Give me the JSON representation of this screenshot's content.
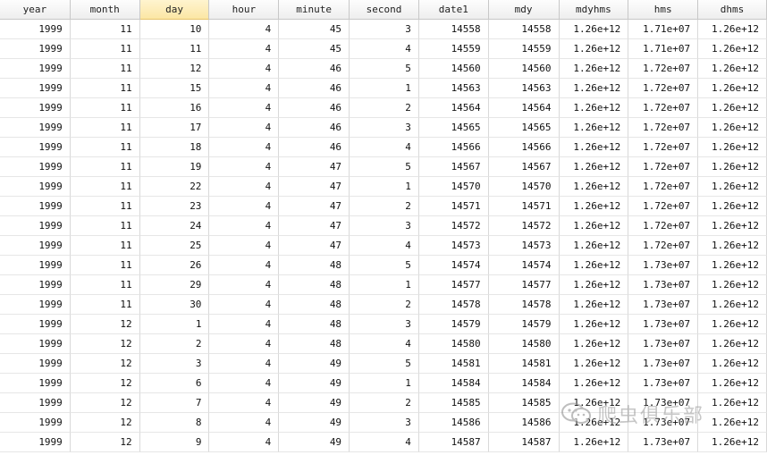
{
  "columns": [
    "year",
    "month",
    "day",
    "hour",
    "minute",
    "second",
    "date1",
    "mdy",
    "mdyhms",
    "hms",
    "dhms"
  ],
  "selected_column": "day",
  "rows": [
    [
      "1999",
      "11",
      "10",
      "4",
      "45",
      "3",
      "14558",
      "14558",
      "1.26e+12",
      "1.71e+07",
      "1.26e+12"
    ],
    [
      "1999",
      "11",
      "11",
      "4",
      "45",
      "4",
      "14559",
      "14559",
      "1.26e+12",
      "1.71e+07",
      "1.26e+12"
    ],
    [
      "1999",
      "11",
      "12",
      "4",
      "46",
      "5",
      "14560",
      "14560",
      "1.26e+12",
      "1.72e+07",
      "1.26e+12"
    ],
    [
      "1999",
      "11",
      "15",
      "4",
      "46",
      "1",
      "14563",
      "14563",
      "1.26e+12",
      "1.72e+07",
      "1.26e+12"
    ],
    [
      "1999",
      "11",
      "16",
      "4",
      "46",
      "2",
      "14564",
      "14564",
      "1.26e+12",
      "1.72e+07",
      "1.26e+12"
    ],
    [
      "1999",
      "11",
      "17",
      "4",
      "46",
      "3",
      "14565",
      "14565",
      "1.26e+12",
      "1.72e+07",
      "1.26e+12"
    ],
    [
      "1999",
      "11",
      "18",
      "4",
      "46",
      "4",
      "14566",
      "14566",
      "1.26e+12",
      "1.72e+07",
      "1.26e+12"
    ],
    [
      "1999",
      "11",
      "19",
      "4",
      "47",
      "5",
      "14567",
      "14567",
      "1.26e+12",
      "1.72e+07",
      "1.26e+12"
    ],
    [
      "1999",
      "11",
      "22",
      "4",
      "47",
      "1",
      "14570",
      "14570",
      "1.26e+12",
      "1.72e+07",
      "1.26e+12"
    ],
    [
      "1999",
      "11",
      "23",
      "4",
      "47",
      "2",
      "14571",
      "14571",
      "1.26e+12",
      "1.72e+07",
      "1.26e+12"
    ],
    [
      "1999",
      "11",
      "24",
      "4",
      "47",
      "3",
      "14572",
      "14572",
      "1.26e+12",
      "1.72e+07",
      "1.26e+12"
    ],
    [
      "1999",
      "11",
      "25",
      "4",
      "47",
      "4",
      "14573",
      "14573",
      "1.26e+12",
      "1.72e+07",
      "1.26e+12"
    ],
    [
      "1999",
      "11",
      "26",
      "4",
      "48",
      "5",
      "14574",
      "14574",
      "1.26e+12",
      "1.73e+07",
      "1.26e+12"
    ],
    [
      "1999",
      "11",
      "29",
      "4",
      "48",
      "1",
      "14577",
      "14577",
      "1.26e+12",
      "1.73e+07",
      "1.26e+12"
    ],
    [
      "1999",
      "11",
      "30",
      "4",
      "48",
      "2",
      "14578",
      "14578",
      "1.26e+12",
      "1.73e+07",
      "1.26e+12"
    ],
    [
      "1999",
      "12",
      "1",
      "4",
      "48",
      "3",
      "14579",
      "14579",
      "1.26e+12",
      "1.73e+07",
      "1.26e+12"
    ],
    [
      "1999",
      "12",
      "2",
      "4",
      "48",
      "4",
      "14580",
      "14580",
      "1.26e+12",
      "1.73e+07",
      "1.26e+12"
    ],
    [
      "1999",
      "12",
      "3",
      "4",
      "49",
      "5",
      "14581",
      "14581",
      "1.26e+12",
      "1.73e+07",
      "1.26e+12"
    ],
    [
      "1999",
      "12",
      "6",
      "4",
      "49",
      "1",
      "14584",
      "14584",
      "1.26e+12",
      "1.73e+07",
      "1.26e+12"
    ],
    [
      "1999",
      "12",
      "7",
      "4",
      "49",
      "2",
      "14585",
      "14585",
      "1.26e+12",
      "1.73e+07",
      "1.26e+12"
    ],
    [
      "1999",
      "12",
      "8",
      "4",
      "49",
      "3",
      "14586",
      "14586",
      "1.26e+12",
      "1.73e+07",
      "1.26e+12"
    ],
    [
      "1999",
      "12",
      "9",
      "4",
      "49",
      "4",
      "14587",
      "14587",
      "1.26e+12",
      "1.73e+07",
      "1.26e+12"
    ]
  ],
  "watermark": {
    "text": "爬虫俱乐部",
    "icon": "wechat-icon"
  },
  "colors": {
    "header_selected": "#fbe6a4",
    "grid_line": "#d9d9d9"
  }
}
